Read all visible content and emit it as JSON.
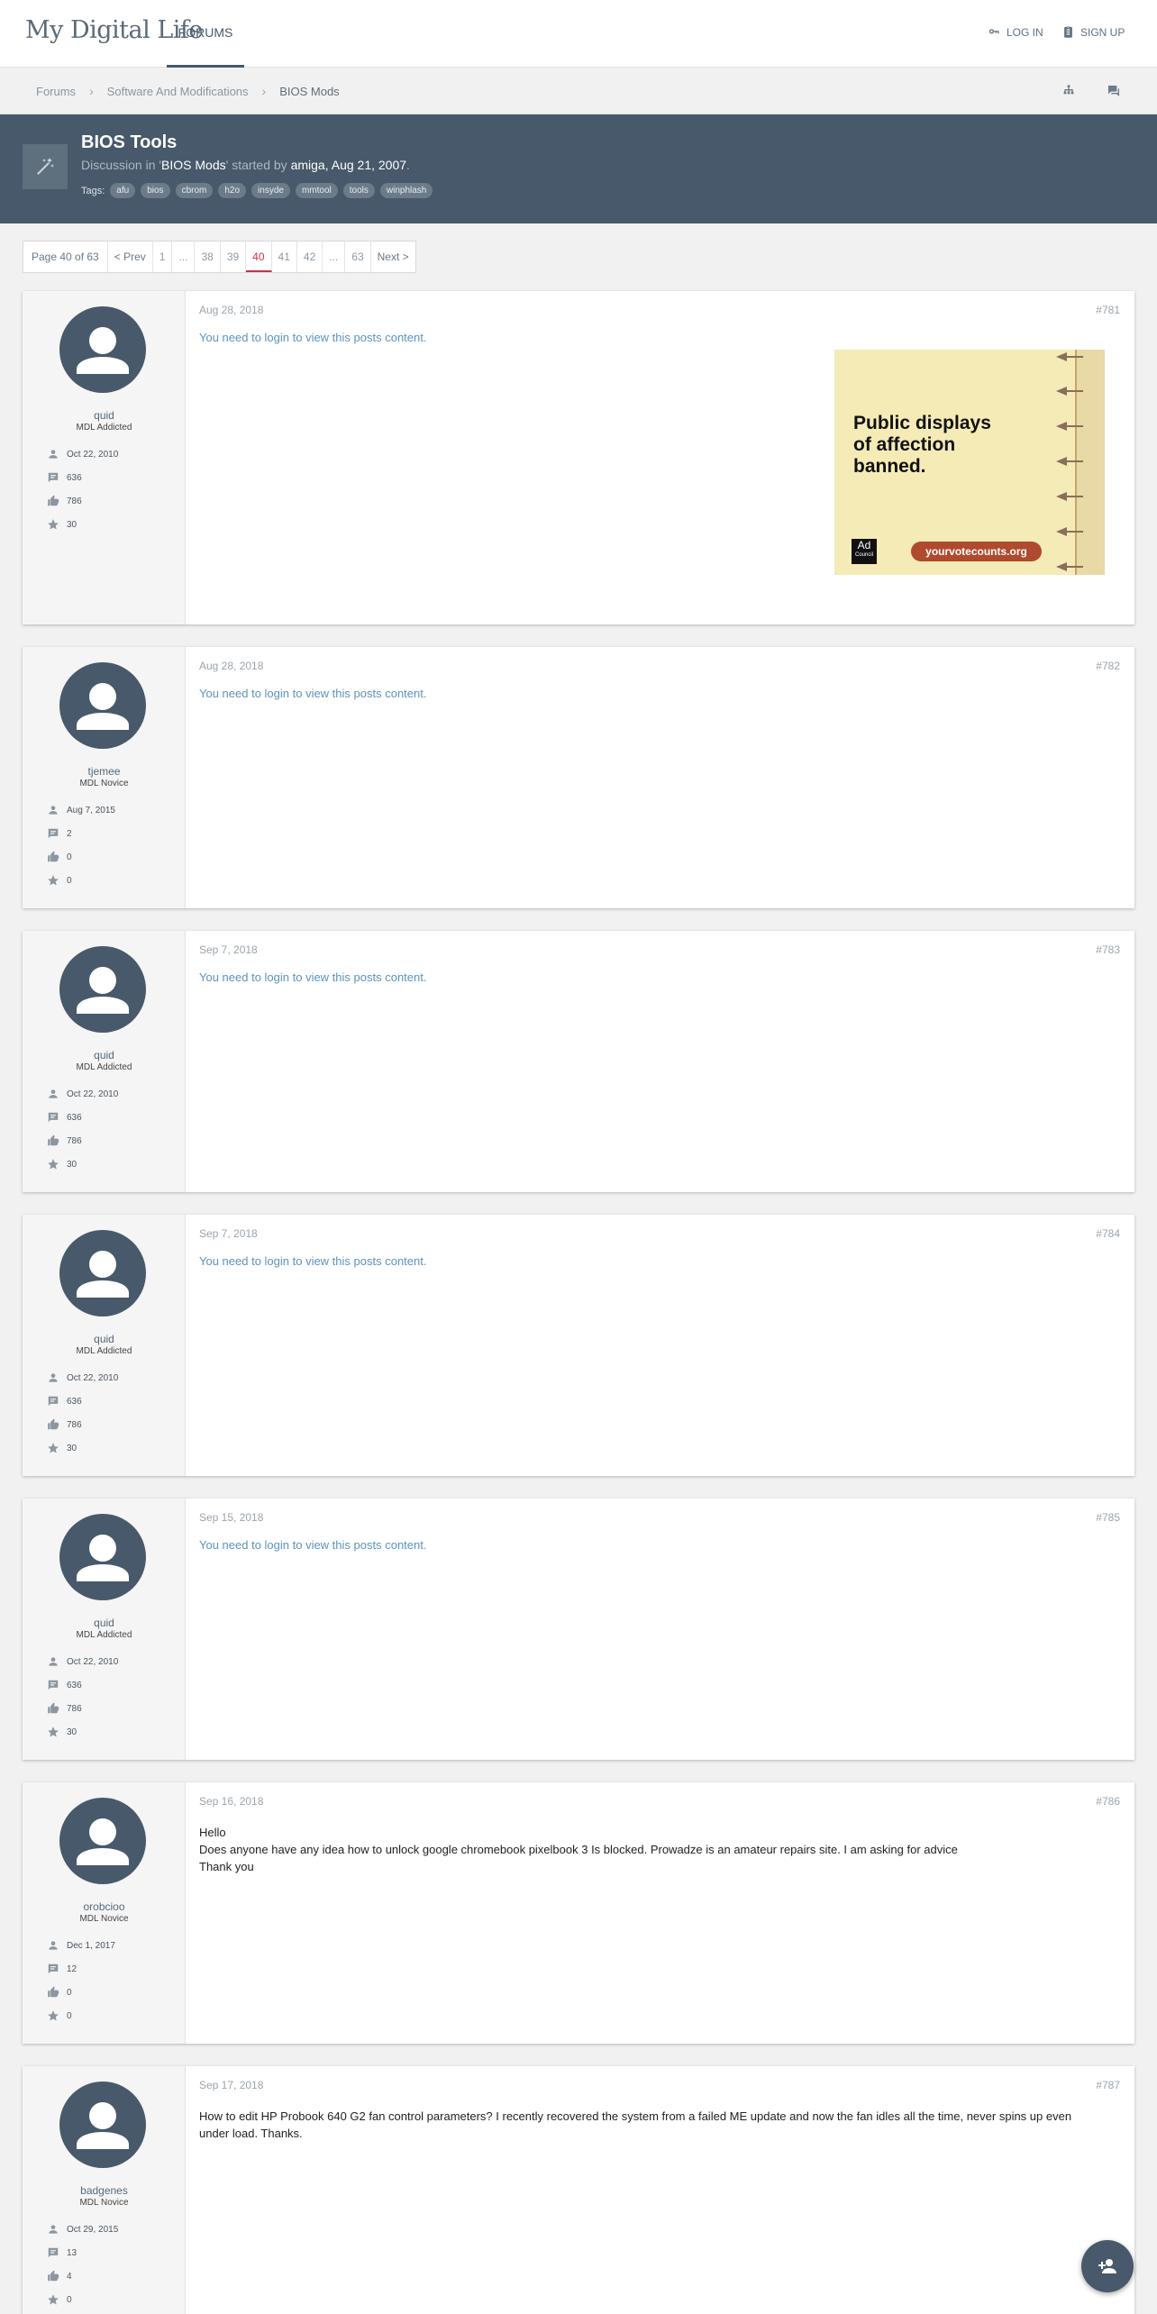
{
  "header": {
    "logo": "My Digital Life",
    "nav_forums": "FORUMS",
    "login": "LOG IN",
    "signup": "SIGN UP"
  },
  "breadcrumb": [
    "Forums",
    "Software And Modifications",
    "BIOS Mods"
  ],
  "thread": {
    "title": "BIOS Tools",
    "sub_prefix": "Discussion in '",
    "forum": "BIOS Mods",
    "sub_mid": "' started by ",
    "author": "amiga",
    "sep": ", ",
    "date": "Aug 21, 2007",
    "end": ".",
    "tags_label": "Tags:",
    "tags": [
      "afu",
      "bios",
      "cbrom",
      "h2o",
      "insyde",
      "mmtool",
      "tools",
      "winphlash"
    ]
  },
  "pagination": {
    "info": "Page 40 of 63",
    "prev": "< Prev",
    "pages": [
      "1",
      "...",
      "38",
      "39",
      "40",
      "41",
      "42",
      "...",
      "63"
    ],
    "active": "40",
    "next": "Next >"
  },
  "login_notice": "You need to login to view this posts content.",
  "posts": [
    {
      "user": "quid",
      "rank": "MDL Addicted",
      "joined": "Oct 22, 2010",
      "messages": "636",
      "likes": "786",
      "points": "30",
      "date": "Aug 28, 2018",
      "number": "#781",
      "body": []
    },
    {
      "user": "tjemee",
      "rank": "MDL Novice",
      "joined": "Aug 7, 2015",
      "messages": "2",
      "likes": "0",
      "points": "0",
      "date": "Aug 28, 2018",
      "number": "#782",
      "body": []
    },
    {
      "user": "quid",
      "rank": "MDL Addicted",
      "joined": "Oct 22, 2010",
      "messages": "636",
      "likes": "786",
      "points": "30",
      "date": "Sep 7, 2018",
      "number": "#783",
      "body": []
    },
    {
      "user": "quid",
      "rank": "MDL Addicted",
      "joined": "Oct 22, 2010",
      "messages": "636",
      "likes": "786",
      "points": "30",
      "date": "Sep 7, 2018",
      "number": "#784",
      "body": []
    },
    {
      "user": "quid",
      "rank": "MDL Addicted",
      "joined": "Oct 22, 2010",
      "messages": "636",
      "likes": "786",
      "points": "30",
      "date": "Sep 15, 2018",
      "number": "#785",
      "body": []
    },
    {
      "user": "orobcioo",
      "rank": "MDL Novice",
      "joined": "Dec 1, 2017",
      "messages": "12",
      "likes": "0",
      "points": "0",
      "date": "Sep 16, 2018",
      "number": "#786",
      "body": [
        "Hello",
        "Does anyone have any idea how to unlock google chromebook pixelbook 3 Is blocked. Prowadze is an amateur repairs site. I am asking for advice",
        "Thank you"
      ]
    },
    {
      "user": "badgenes",
      "rank": "MDL Novice",
      "joined": "Oct 29, 2015",
      "messages": "13",
      "likes": "4",
      "points": "0",
      "date": "Sep 17, 2018",
      "number": "#787",
      "body": [
        "How to edit HP Probook 640 G2 fan control parameters? I recently recovered the system from a failed ME update and now the fan idles all the time, never spins up even under load. Thanks."
      ]
    }
  ],
  "ad": {
    "headline": [
      "Public displays",
      "of affection",
      "banned."
    ],
    "logo": [
      "Ad",
      "Council"
    ],
    "url": "yourvotecounts.org"
  }
}
